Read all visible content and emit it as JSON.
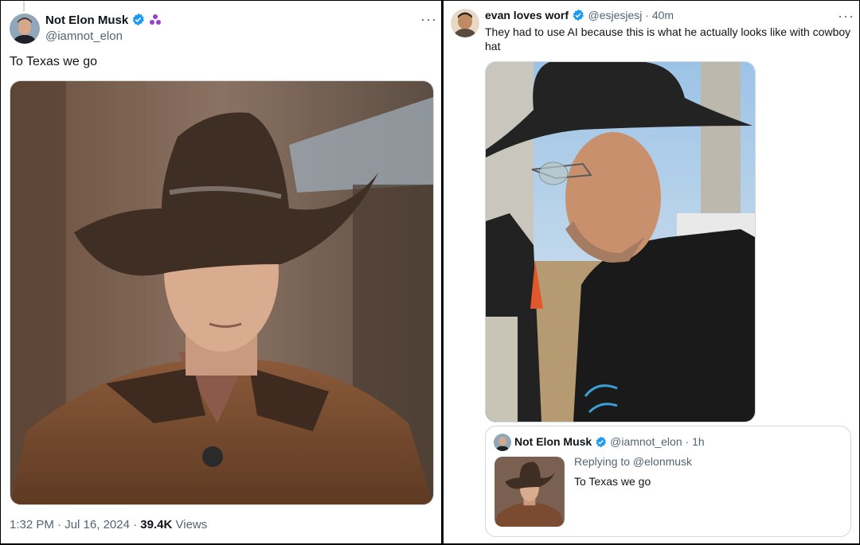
{
  "left_tweet": {
    "author_name": "Not Elon Musk",
    "author_handle": "@iamnot_elon",
    "text": "To Texas we go",
    "time": "1:32 PM",
    "date": "Jul 16, 2024",
    "views_count": "39.4K",
    "views_label": "Views",
    "image_desc_icon": "cowboy-portrait-image"
  },
  "right_tweet": {
    "author_name": "evan loves worf",
    "author_handle": "@esjesjesj",
    "age": "40m",
    "text": "They had to use AI because this is what he actually looks like with cowboy hat",
    "quote": {
      "author_name": "Not Elon Musk",
      "author_handle": "@iamnot_elon",
      "age": "1h",
      "replying_to": "Replying to @elonmusk",
      "text": "To Texas we go"
    }
  },
  "colors": {
    "verified": "#1d9bf0",
    "affiliate_badge": "#9b3fd1",
    "secondary_text": "#536471",
    "border": "#cfd9de"
  }
}
